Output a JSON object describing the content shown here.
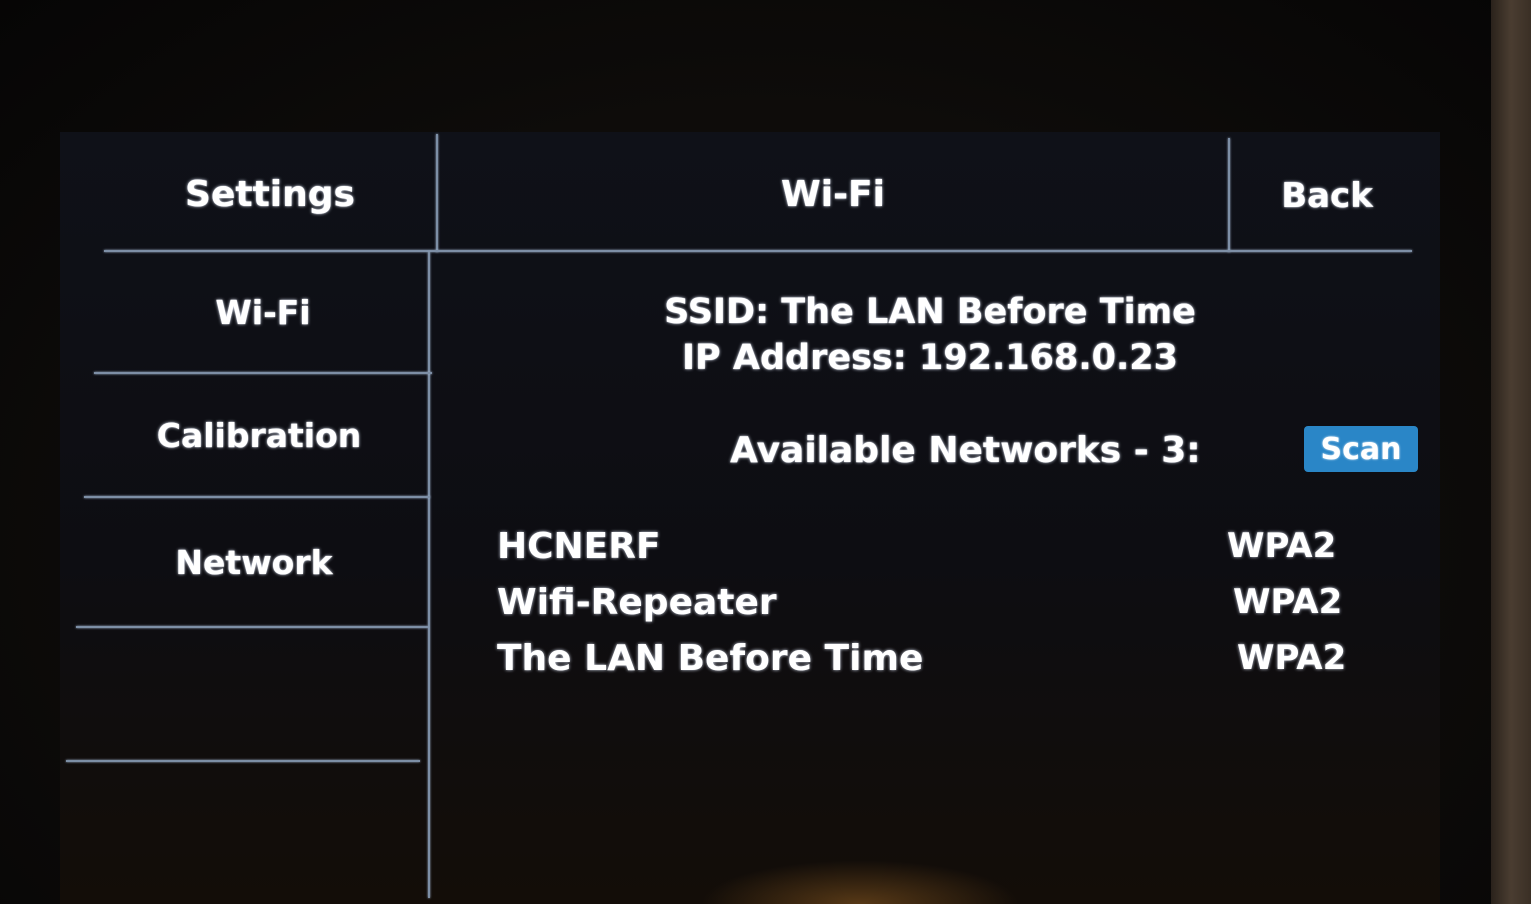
{
  "header": {
    "settings_title": "Settings",
    "page_title": "Wi-Fi",
    "back_label": "Back"
  },
  "sidebar": {
    "items": [
      {
        "label": "Wi-Fi"
      },
      {
        "label": "Calibration"
      },
      {
        "label": "Network"
      },
      {
        "label": ""
      },
      {
        "label": ""
      }
    ]
  },
  "status": {
    "ssid_line": "SSID: The LAN Before Time",
    "ip_line": "IP Address: 192.168.0.23"
  },
  "networks": {
    "heading": "Available Networks - 3:",
    "scan_label": "Scan",
    "scan_color": "#2a86c7",
    "list": [
      {
        "name": "HCNERF",
        "security": "WPA2"
      },
      {
        "name": "Wifi-Repeater",
        "security": "WPA2"
      },
      {
        "name": "The LAN Before Time",
        "security": "WPA2"
      }
    ]
  }
}
